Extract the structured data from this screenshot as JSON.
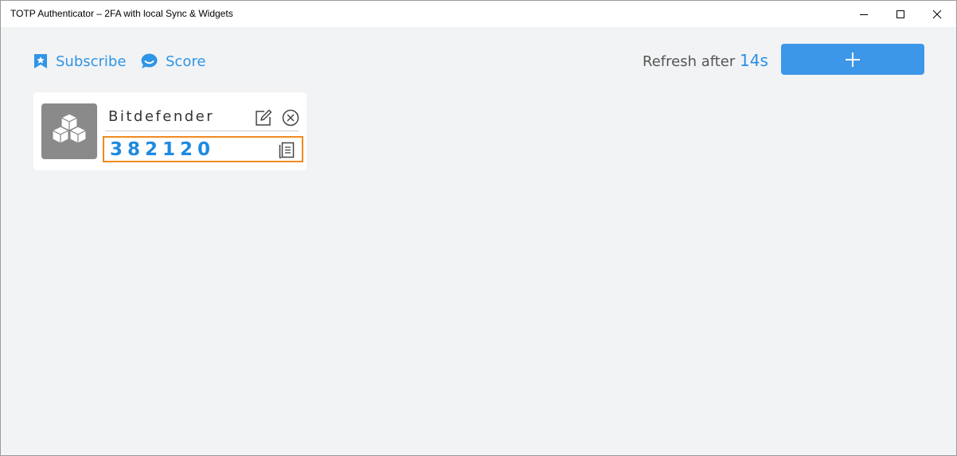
{
  "window": {
    "title": "TOTP Authenticator – 2FA with local Sync & Widgets"
  },
  "header": {
    "subscribe_label": "Subscribe",
    "subscribe_icon": "bookmark-star-icon",
    "score_label": "Score",
    "score_icon": "chat-bubble-icon",
    "refresh_label": "Refresh after",
    "refresh_seconds": "14s",
    "add_icon": "plus-icon"
  },
  "accounts": [
    {
      "name": "Bitdefender",
      "code": "382120",
      "logo_icon": "cubes-icon"
    }
  ],
  "colors": {
    "accent": "#2f95e6",
    "add_button": "#3d97e8",
    "code_text": "#1f8ae0",
    "highlight_border": "#f08a1f",
    "logo_bg": "#8a8a8a",
    "background": "#f2f3f5"
  }
}
